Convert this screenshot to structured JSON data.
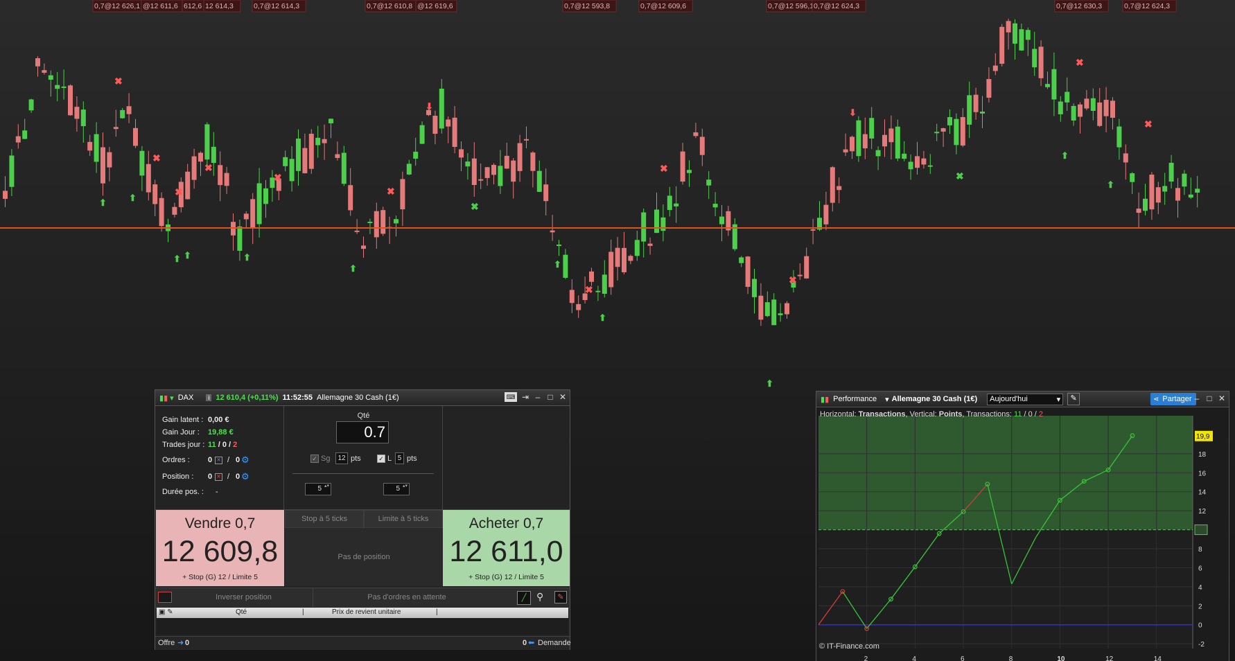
{
  "chart": {
    "top_labels": [
      "0,7@12 626,1",
      "@12 611,6",
      "612,6",
      "12 614,3",
      "0,7@12 614,3",
      "0,7@12 610,8",
      "@12 619,6",
      "0,7@12 593,8",
      "0,7@12 609,6",
      "0,7@12 596,1",
      "0,7@12 624,3",
      "0,7@12 630,3",
      "0,7@12 624,3"
    ]
  },
  "trade_panel": {
    "instrument": "DAX",
    "price_change": "12 610,4 (+0,11%)",
    "time": "11:52:55",
    "market_name": "Allemagne 30 Cash (1€)",
    "stats": {
      "gain_latent_label": "Gain latent :",
      "gain_latent_value": "0,00 €",
      "gain_jour_label": "Gain Jour :",
      "gain_jour_value": "19,88 €",
      "trades_jour_label": "Trades jour :",
      "trades_win": "11",
      "trades_sep1": " / ",
      "trades_even": "0",
      "trades_sep2": " / ",
      "trades_loss": "2",
      "ordres_label": "Ordres :",
      "ordres_a": "0",
      "ordres_b": "0",
      "position_label": "Position :",
      "position_a": "0",
      "position_b": "0",
      "duree_label": "Durée pos. :",
      "duree_value": "-",
      "slash": "/"
    },
    "qty_label": "Qté",
    "qty_value": "0.7",
    "sg_label": "Sg",
    "sg_value": "12",
    "pts_label": "pts",
    "l_label": "L",
    "l_value": "5",
    "spin_left": "5",
    "spin_right": "5",
    "sell": {
      "title": "Vendre 0,7",
      "price": "12 609,8",
      "sub": "+ Stop (G) 12 / Limite 5"
    },
    "buy": {
      "title": "Acheter 0,7",
      "price": "12 611,0",
      "sub": "+ Stop (G) 12 / Limite 5"
    },
    "stop_ticks": "Stop à 5 ticks",
    "limite_ticks": "Limite à 5 ticks",
    "no_position": "Pas de position",
    "reverse_position": "Inverser position",
    "no_orders": "Pas d'ordres en attente",
    "table_headers": [
      "Qté",
      "Prix de revient unitaire"
    ],
    "offre_label": "Offre",
    "offre_value": "0",
    "demande_value": "0",
    "demande_label": "Demande"
  },
  "perf_panel": {
    "title": "Performance",
    "market": "Allemagne 30 Cash (1€)",
    "period": "Aujourd'hui",
    "share_label": "Partager",
    "legend_horizontal": "Horizontal: ",
    "legend_h_val": "Transactions",
    "legend_vertical": ", Vertical: ",
    "legend_v_val": "Points",
    "legend_transactions": ", Transactions: ",
    "legend_win": "11",
    "legend_sep": " / ",
    "legend_even": "0",
    "legend_loss": "2",
    "copyright": "© IT-Finance.com"
  },
  "chart_data": {
    "type": "line",
    "x": [
      0,
      1,
      2,
      3,
      4,
      5,
      6,
      7,
      8,
      9,
      10,
      11,
      12,
      13
    ],
    "values": [
      0,
      3.5,
      -0.4,
      2.7,
      6.1,
      9.6,
      11.9,
      14.8,
      4.3,
      9.2,
      13.1,
      15.1,
      16.3,
      19.9
    ],
    "losing_segments": [
      [
        0,
        1
      ],
      [
        6,
        7
      ]
    ],
    "last_value_label": "19,9",
    "xlim": [
      0,
      15.5
    ],
    "ylim": [
      -2.5,
      22
    ],
    "x_ticks": [
      "2",
      "4",
      "6",
      "8",
      "10",
      "12",
      "14"
    ],
    "y_ticks": [
      "-2",
      "0",
      "2",
      "4",
      "6",
      "8",
      "10",
      "12",
      "14",
      "16",
      "18"
    ],
    "threshold_line": 10,
    "zero_line": 0,
    "colors": {
      "up": "#35c635",
      "down": "#d43b3b",
      "fill": "#2f5a2f",
      "zero": "#2a2aff",
      "threshold": "#5fbf5f",
      "highlight": "#f2e600"
    }
  }
}
